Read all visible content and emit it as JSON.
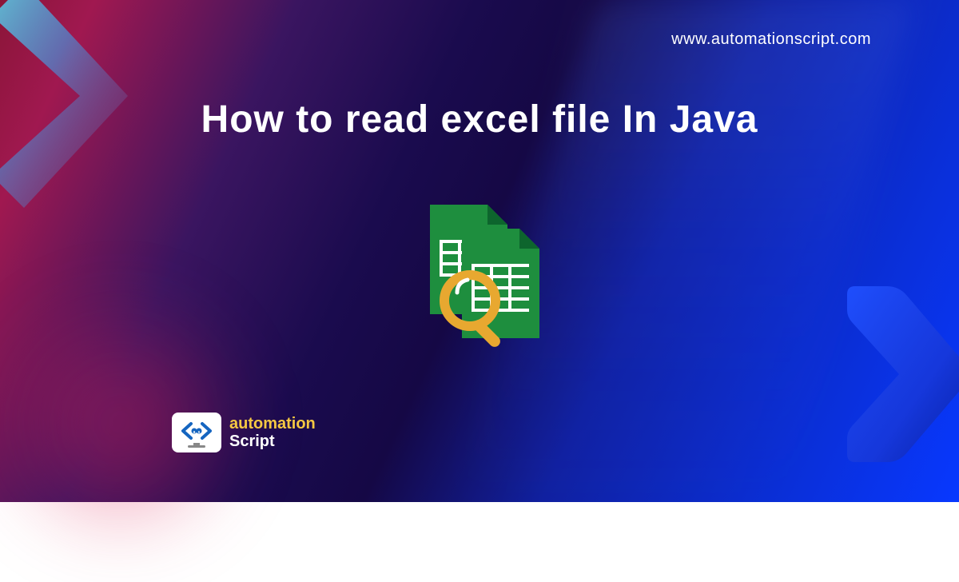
{
  "website_url": "www.automationscript.com",
  "main_title": "How to read excel file In Java",
  "logo": {
    "line1": "automation",
    "line2": "Script"
  },
  "colors": {
    "accent_yellow": "#f5c842",
    "sheet_green": "#1e8e3e",
    "sheet_green_dark": "#0d652d"
  }
}
